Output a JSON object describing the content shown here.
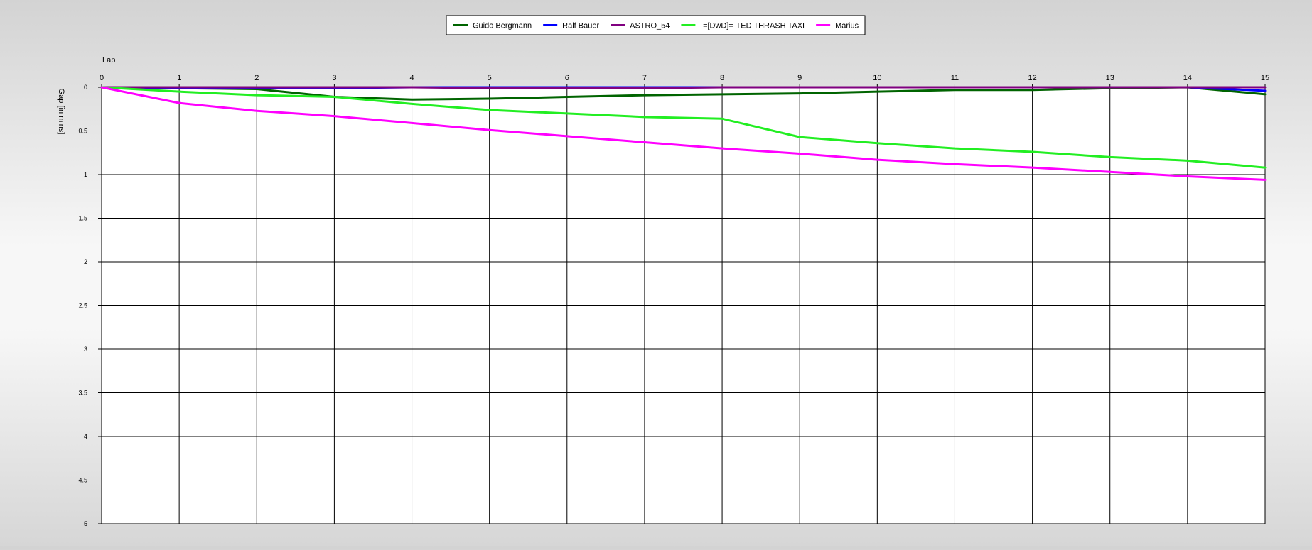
{
  "chart_data": {
    "type": "line",
    "xlabel": "Lap",
    "ylabel": "Gap [in mins]",
    "x": [
      0,
      1,
      2,
      3,
      4,
      5,
      6,
      7,
      8,
      9,
      10,
      11,
      12,
      13,
      14,
      15
    ],
    "xlim": [
      0,
      15
    ],
    "ylim": [
      0,
      5
    ],
    "y_inverted": true,
    "x_axis_position": "top",
    "legend_position": "top-center",
    "grid": true,
    "yticks": [
      "0",
      "0.5",
      "1",
      "1.5",
      "2",
      "2.5",
      "3",
      "3.5",
      "4",
      "4.5",
      "5"
    ],
    "xticks": [
      "0",
      "1",
      "2",
      "3",
      "4",
      "5",
      "6",
      "7",
      "8",
      "9",
      "10",
      "11",
      "12",
      "13",
      "14",
      "15"
    ],
    "series": [
      {
        "name": "Guido Bergmann",
        "color": "#006400",
        "values": [
          0,
          0.01,
          0.02,
          0.11,
          0.14,
          0.13,
          0.11,
          0.09,
          0.08,
          0.07,
          0.05,
          0.03,
          0.03,
          0.01,
          0.0,
          0.08
        ]
      },
      {
        "name": "Ralf Bauer",
        "color": "#0000ff",
        "values": [
          0,
          0.01,
          0.01,
          0.01,
          0.0,
          0.0,
          0.0,
          0.0,
          0.0,
          0.0,
          0.0,
          0.0,
          0.0,
          0.0,
          0.0,
          0.04
        ]
      },
      {
        "name": "ASTRO_54",
        "color": "#800080",
        "values": [
          0,
          0.0,
          0.0,
          0.0,
          0.0,
          0.01,
          0.01,
          0.01,
          0.0,
          0.0,
          0.0,
          0.0,
          0.0,
          0.0,
          0.0,
          0.0
        ]
      },
      {
        "name": "-=[DwD]=-TED THRASH TAXI",
        "color": "#22ee22",
        "values": [
          0,
          0.05,
          0.09,
          0.11,
          0.19,
          0.26,
          0.3,
          0.34,
          0.36,
          0.57,
          0.64,
          0.7,
          0.74,
          0.8,
          0.84,
          0.92
        ]
      },
      {
        "name": "Marius",
        "color": "#ff00ff",
        "values": [
          0,
          0.18,
          0.27,
          0.33,
          0.41,
          0.49,
          0.56,
          0.63,
          0.7,
          0.76,
          0.83,
          0.88,
          0.92,
          0.97,
          1.02,
          1.06
        ]
      }
    ]
  }
}
